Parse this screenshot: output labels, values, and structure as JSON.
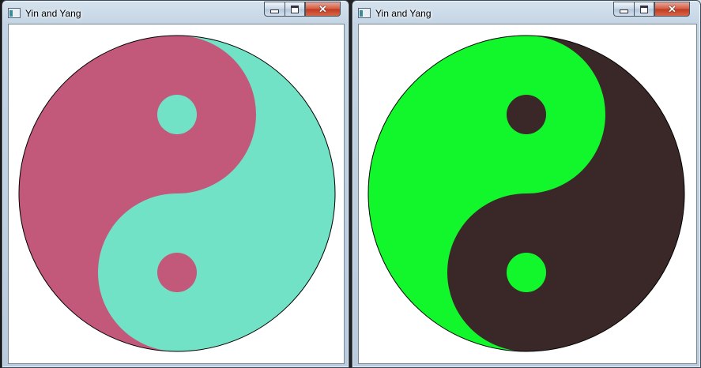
{
  "windows": [
    {
      "title": "Yin and Yang",
      "icons": {
        "app": "window-app-icon",
        "minimize": "minimize-icon",
        "maximize": "maximize-icon",
        "close": "close-icon"
      },
      "close_glyph": "✕",
      "colors": {
        "yin": "#c2587a",
        "yang": "#72e2c6",
        "outline": "#000000",
        "background": "#ffffff"
      }
    },
    {
      "title": "Yin and Yang",
      "icons": {
        "app": "window-app-icon",
        "minimize": "minimize-icon",
        "maximize": "maximize-icon",
        "close": "close-icon"
      },
      "close_glyph": "✕",
      "colors": {
        "yin": "#12f72c",
        "yang": "#3a2828",
        "outline": "#000000",
        "background": "#ffffff"
      }
    }
  ]
}
